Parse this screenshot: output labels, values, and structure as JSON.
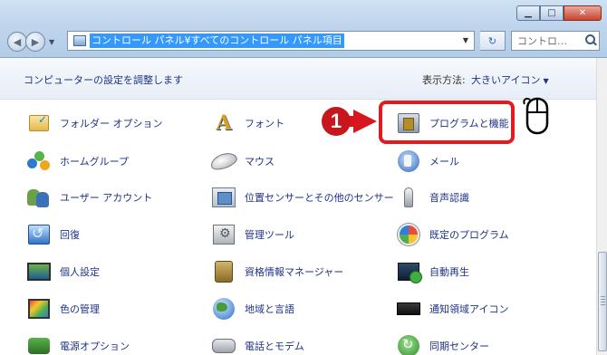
{
  "window": {
    "controls": {
      "minimize": "▁",
      "maximize": "□",
      "close": "✕"
    }
  },
  "nav": {
    "address": "コントロール パネル¥すべてのコントロール パネル項目",
    "search_placeholder": "コントロ…"
  },
  "header": {
    "title": "コンピューターの設定を調整します",
    "view_by_label": "表示方法:",
    "view_by_value": "大きいアイコン"
  },
  "items": [
    {
      "label": "フォルダー オプション",
      "icon": "folder-options-icon"
    },
    {
      "label": "フォント",
      "icon": "fonts-icon"
    },
    {
      "label": "プログラムと機能",
      "icon": "programs-features-icon"
    },
    {
      "label": "ホームグループ",
      "icon": "homegroup-icon"
    },
    {
      "label": "マウス",
      "icon": "mouse-icon"
    },
    {
      "label": "メール",
      "icon": "mail-icon"
    },
    {
      "label": "ユーザー アカウント",
      "icon": "user-accounts-icon"
    },
    {
      "label": "位置センサーとその他のセンサー",
      "icon": "location-sensors-icon"
    },
    {
      "label": "音声認識",
      "icon": "speech-recognition-icon"
    },
    {
      "label": "回復",
      "icon": "recovery-icon"
    },
    {
      "label": "管理ツール",
      "icon": "admin-tools-icon"
    },
    {
      "label": "既定のプログラム",
      "icon": "default-programs-icon"
    },
    {
      "label": "個人設定",
      "icon": "personalization-icon"
    },
    {
      "label": "資格情報マネージャー",
      "icon": "credential-manager-icon"
    },
    {
      "label": "自動再生",
      "icon": "autoplay-icon"
    },
    {
      "label": "色の管理",
      "icon": "color-management-icon"
    },
    {
      "label": "地域と言語",
      "icon": "region-language-icon"
    },
    {
      "label": "通知領域アイコン",
      "icon": "notification-area-icon"
    },
    {
      "label": "電源オプション",
      "icon": "power-options-icon"
    },
    {
      "label": "電話とモデム",
      "icon": "phone-modem-icon"
    },
    {
      "label": "同期センター",
      "icon": "sync-center-icon"
    }
  ],
  "annotation": {
    "step_number": "1",
    "highlight_color": "#e8191e"
  },
  "colors": {
    "link": "#1e3287",
    "highlight": "#3399ff"
  }
}
